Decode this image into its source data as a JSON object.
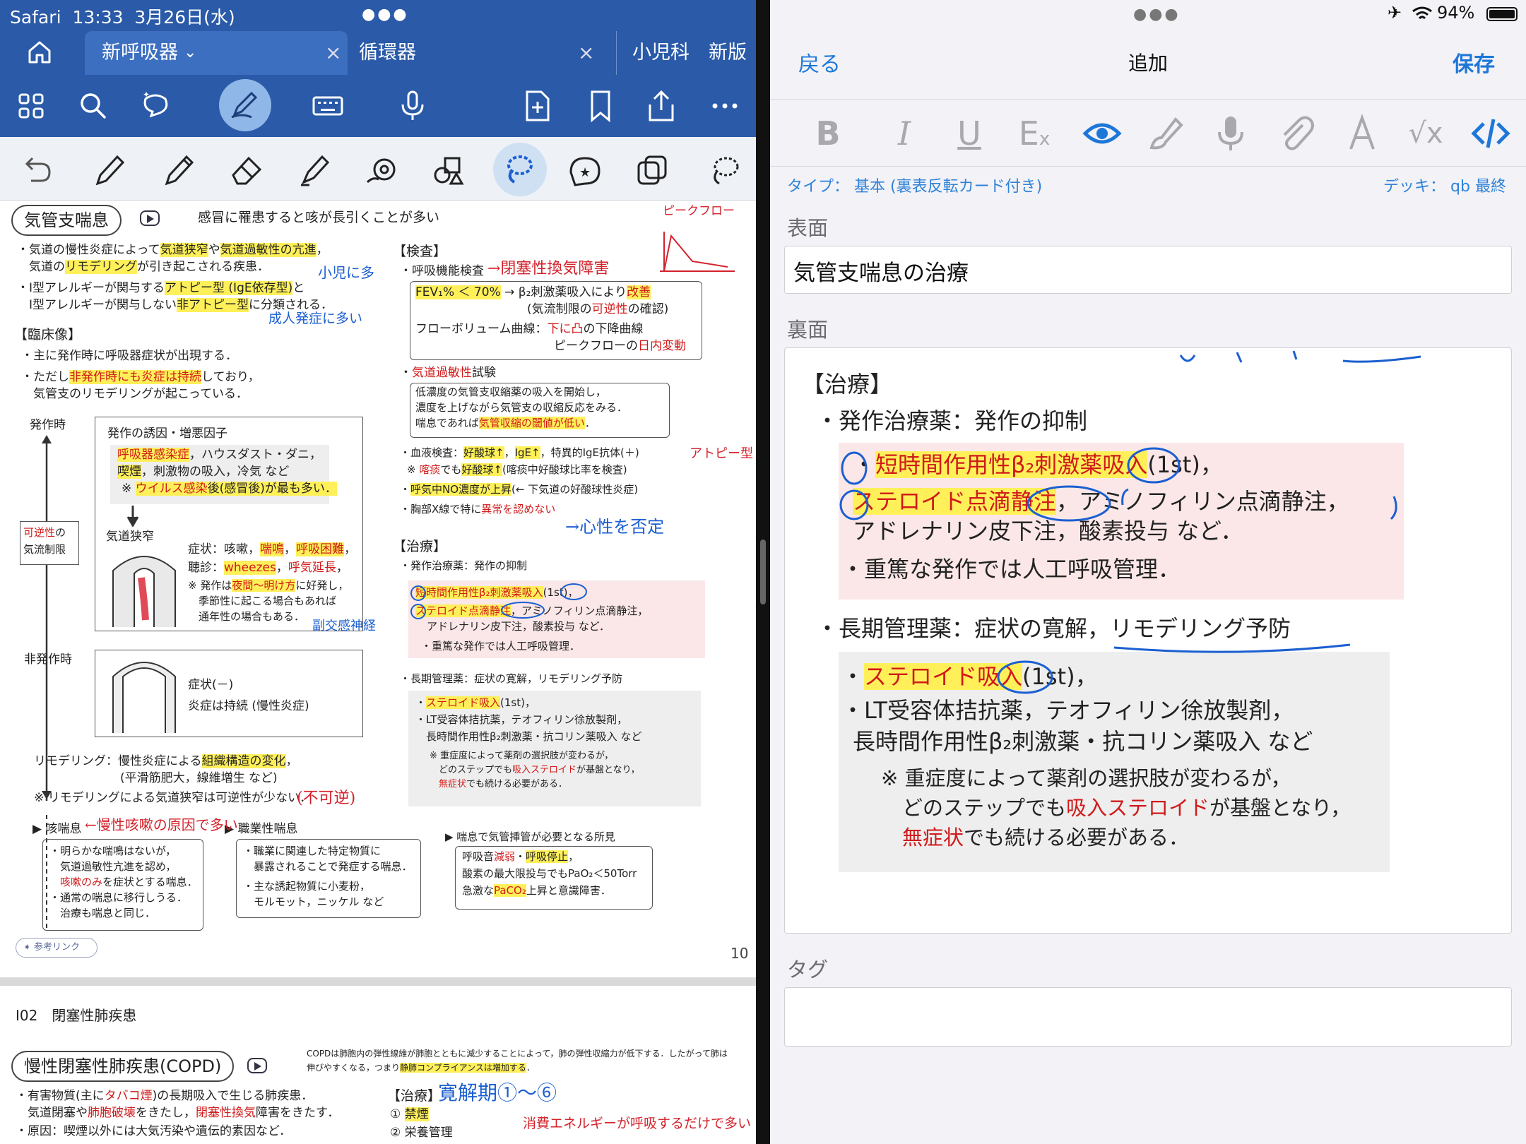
{
  "left_app": {
    "status": {
      "app": "Safari",
      "time": "13:33",
      "date": "3月26日(水)"
    },
    "tabs": [
      {
        "label": "新呼吸器"
      },
      {
        "label": "循環器"
      },
      {
        "label": "小児科　新版"
      }
    ],
    "page": {
      "title": "気管支喘息",
      "intro": "感冒に罹患すると咳が長引くことが多い",
      "page_number": "10",
      "ref_link": "参考リンク",
      "lines": {
        "d1": "・気道の慢性炎症によって",
        "d1a": "気道狭窄",
        "d1b": "や",
        "d1c": "気道過敏性の亢進",
        "d1d": "，",
        "d2": "　気道の",
        "d2a": "リモデリング",
        "d2b": "が引き起こされる疾患．",
        "d3": "・Ⅰ型アレルギーが関与する",
        "d3a": "アトピー型 (IgE依存型)",
        "d3b": "と",
        "d4": "　Ⅰ型アレルギーが関与しない",
        "d4a": "非アトピー型",
        "d4b": "に分類される．",
        "clin_head": "【臨床像】",
        "c1": "・主に発作時に呼吸器症状が出現する．",
        "c2": "・ただし",
        "c2a": "非発作時にも炎症は持続",
        "c2b": "しており，",
        "c3": "　気管支のリモデリングが起こっている．",
        "attack": "発作時",
        "trig_head": "発作の誘因・増悪因子",
        "trig1a": "呼吸器感染症",
        "trig1b": "，ハウスダスト・ダニ，",
        "trig2a": "喫煙",
        "trig2b": "，刺激物の吸入，冷気 など",
        "trig3a": "※ ",
        "trig3b": "ウイルス感染",
        "trig3c": "後(感冒後)が最も多い．",
        "rev1": "可逆性",
        "rev1b": "の",
        "rev2": "気流制限",
        "narrow": "気道狭窄",
        "sym1": "症状：咳嗽，",
        "sym1a": "喘鳴",
        "sym1b": "，",
        "sym1c": "呼吸困難",
        "sym1d": "，",
        "aus1": "聴診：",
        "aus1a": "wheezes",
        "aus1b": "，",
        "aus1c": "呼気延長",
        "aus1d": "，",
        "note1": "※ 発作は",
        "note1a": "夜間～明け方",
        "note1b": "に好発し，",
        "note2": "　季節性に起こる場合もあれば",
        "note3": "　通年性の場合もある．",
        "nonattack": "非発作時",
        "ns1": "症状(－)",
        "ns2": "炎症は持続 (慢性炎症)",
        "remod1": "リモデリング：慢性炎症による",
        "remod1a": "組織構造の変化",
        "remod1b": "，",
        "remod2": "(平滑筋肥大，線維増生 など)",
        "remod3": "※ リモデリングによる気道狭窄は可逆性が少ない．",
        "cough_head": "▶ 咳喘息",
        "cough1": "・明らかな喘鳴はないが，",
        "cough2": "　気道過敏性亢進を認め，",
        "cough3a": "　咳嗽のみ",
        "cough3b": "を症状とする喘息．",
        "cough4": "・通常の喘息に移行しうる．",
        "cough5": "　治療も喘息と同じ．",
        "occ_head": "▶ 職業性喘息",
        "occ1": "・職業に関連した特定物質に",
        "occ2": "　暴露されることで発症する喘息．",
        "occ3": "・主な誘起物質に小麦粉，",
        "occ4": "　モルモット，ニッケル など",
        "intub_head": "▶ 喘息で気管挿管が必要となる所見",
        "intub1a": "呼吸音",
        "intub1b": "減弱",
        "intub1c": "・",
        "intub1d": "呼吸停止",
        "intub1e": "，",
        "intub2": "酸素の最大限投与でもPaO₂＜50Torr",
        "intub3a": "急激な",
        "intub3b": "PaCO₂",
        "intub3c": "上昇と意識障害．",
        "exam_head": "【検査】",
        "ex1": "・呼吸機能検査",
        "ex2a": "FEV₁% ＜ 70%",
        "ex2b": " → β₂刺激薬吸入により",
        "ex2c": "改善",
        "ex3a": "(気流制限の",
        "ex3b": "可逆性",
        "ex3c": "の確認)",
        "ex4a": "フローボリューム曲線：",
        "ex4b": "下に凸",
        "ex4c": "の下降曲線",
        "ex5a": "ピークフローの",
        "ex5b": "日内変動",
        "ex6a": "・",
        "ex6b": "気道過敏性",
        "ex6c": "試験",
        "ex7": "低濃度の気管支収縮薬の吸入を開始し，",
        "ex8": "濃度を上げながら気管支の収縮反応をみる．",
        "ex9a": "喘息であれば",
        "ex9b": "気管収縮の閾値が低い",
        "ex9c": "．",
        "ex10a": "・血液検査：",
        "ex10b": "好酸球↑",
        "ex10c": "，",
        "ex10d": "IgE↑",
        "ex10e": "，特異的IgE抗体(＋)",
        "ex11a": "※ ",
        "ex11b": "喀痰",
        "ex11c": "でも",
        "ex11d": "好酸球↑",
        "ex11e": "(喀痰中好酸球比率を検査)",
        "ex12a": "・",
        "ex12b": "呼気中NO濃度が上昇",
        "ex12c": "(← 下気道の好酸球性炎症)",
        "ex13a": "・胸部X線で特に",
        "ex13b": "異常を認めない",
        "tx_head": "【治療】",
        "tx1": "・発作治療薬：発作の抑制",
        "tx2a": "短時間作用性β₂刺激薬吸入",
        "tx2b": "(1st)，",
        "tx3a": "ステロイド点滴静注",
        "tx3b": "，アミノフィリン点滴静注，",
        "tx4": "アドレナリン皮下注，酸素投与 など．",
        "tx5": "・重篤な発作では人工呼吸管理．",
        "tx6": "・長期管理薬：症状の寛解，リモデリング予防",
        "tx7a": "・",
        "tx7b": "ステロイド吸入",
        "tx7c": "(1st)，",
        "tx8": "・LT受容体拮抗薬，テオフィリン徐放製剤，",
        "tx9": "　長時間作用性β₂刺激薬・抗コリン薬吸入 など",
        "tx10": "※ 重症度によって薬剤の選択肢が変わるが，",
        "tx11a": "　どのステップでも",
        "tx11b": "吸入ステロイド",
        "tx11c": "が基盤となり，",
        "tx12a": "　",
        "tx12b": "無症状",
        "tx12c": "でも続ける必要がある．"
      },
      "handwriting": {
        "h_peak": "ピークフロー",
        "h_ikagaku": "→閉塞性換気障害",
        "h_shoni": "小児に多",
        "h_seijin": "成人発症に多い",
        "h_atopy": "アトピー型",
        "h_shinsei": "→心性を否定",
        "h_fukugen": "(不可逆)",
        "h_chronic": "←慢性咳嗽の原因で多い",
        "h_fukusai": "副交感神経",
        "h_kanjuku": "寛解期①〜⑥",
        "h_shohi": "消費エネルギーが呼吸するだけで多い"
      }
    },
    "page2": {
      "code": "I02　閉塞性肺疾患",
      "title": "慢性閉塞性肺疾患(COPD)",
      "desc1": "COPDは肺胞内の弾性線維が肺胞とともに減少することによって，肺の弾性収縮力が低下する．したがって肺は",
      "desc2a": "伸びやすくなる，つまり",
      "desc2b": "静肺コンプライアンスは増加する",
      "desc2c": "．",
      "l1a": "・有害物質(主に",
      "l1b": "タバコ煙",
      "l1c": ")の長期吸入で生じる肺疾患．",
      "l2a": "　気道閉塞や",
      "l2b": "肺胞破壊",
      "l2c": "をきたし，",
      "l2d": "閉塞性換気",
      "l2e": "障害をきたす．",
      "l3": "・原因：喫煙以外には大気汚染や遺伝的素因など．",
      "tx_head": "【治療】",
      "tx1a": "① ",
      "tx1b": "禁煙",
      "tx2": "② 栄養管理"
    }
  },
  "right_app": {
    "status": {
      "battery": "94%"
    },
    "nav": {
      "back": "戻る",
      "title": "追加",
      "save": "保存"
    },
    "type_label": "タイプ：",
    "type_value": "基本 (裏表反転カード付き)",
    "deck_label": "デッキ：",
    "deck_value": "qb 最終",
    "front_label": "表面",
    "front_value": "気管支喘息の治療",
    "back_label": "裏面",
    "tags_label": "タグ",
    "back": {
      "head": "【治療】",
      "b1": "・発作治療薬：発作の抑制",
      "b2a": "・",
      "b2b": "短時間作用性β₂刺激薬吸入",
      "b2c": "(1st)，",
      "b3a": "ステロイド点滴静注",
      "b3b": "，アミノフィリン点滴静注，",
      "b4": "アドレナリン皮下注，酸素投与 など．",
      "b5": "・重篤な発作では人工呼吸管理．",
      "b6": "・長期管理薬：症状の寛解，リモデリング予防",
      "b7a": "・",
      "b7b": "ステロイド吸入",
      "b7c": "(1st)，",
      "b8": "・LT受容体拮抗薬，テオフィリン徐放製剤，",
      "b9": "長時間作用性β₂刺激薬・抗コリン薬吸入 など",
      "b10": "※ 重症度によって薬剤の選択肢が変わるが，",
      "b11a": "どのステップでも",
      "b11b": "吸入ステロイド",
      "b11c": "が基盤となり，",
      "b12a": "無症状",
      "b12b": "でも続ける必要がある．"
    },
    "format_icons": [
      "bold-icon",
      "italic-icon",
      "underline-icon",
      "clear-format-icon",
      "preview-icon",
      "brush-icon",
      "microphone-icon",
      "attachment-icon",
      "ink-icon",
      "math-icon",
      "code-icon"
    ]
  },
  "colors": {
    "chrome_blue": "#2a5aa8",
    "accent_blue": "#1d77d8",
    "highlight": "#fff05a",
    "red_text": "#d01a1a",
    "ink_blue": "#1b5fd1",
    "ink_red": "#d3222c"
  }
}
